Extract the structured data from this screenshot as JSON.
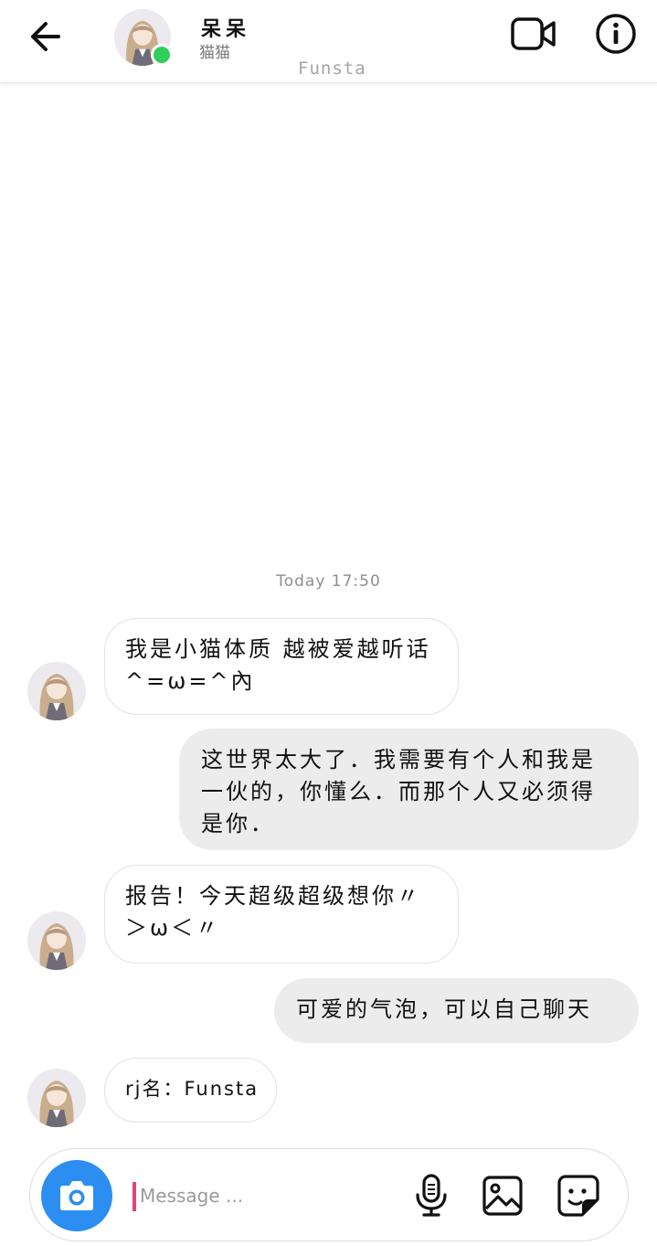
{
  "header": {
    "contact_name": "呆呆",
    "contact_subtitle": "猫猫",
    "brand_label": "Funsta",
    "status": "online",
    "status_color": "#2fcf5a"
  },
  "icons": {
    "back": "arrow-left-icon",
    "video": "video-camera-icon",
    "info": "info-icon",
    "camera": "camera-icon",
    "mic": "microphone-icon",
    "gallery": "image-icon",
    "sticker": "sticker-icon"
  },
  "chat": {
    "timestamp": "Today 17:50",
    "messages": [
      {
        "direction": "in",
        "text": "我是小猫体质 越被爱越听话^=ω=^內"
      },
      {
        "direction": "out",
        "text": "这世界太大了．我需要有个人和我是一伙的，你懂么．而那个人又必须得是你．"
      },
      {
        "direction": "in",
        "text": "报告！今天超级超级想你〃＞ω＜〃"
      },
      {
        "direction": "out",
        "text": "可爱的气泡，可以自己聊天"
      },
      {
        "direction": "in",
        "text": "rj名：Funsta"
      }
    ]
  },
  "composer": {
    "placeholder": "Message ...",
    "value": "",
    "camera_color": "#2b8ef0",
    "caret_color": "#e0457b"
  }
}
